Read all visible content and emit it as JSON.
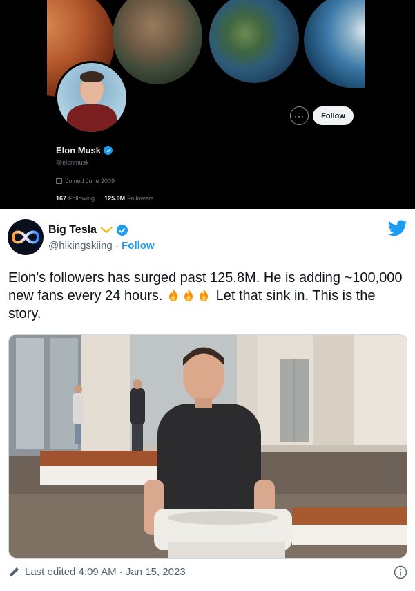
{
  "profile": {
    "name": "Elon Musk",
    "handle": "@elonmusk",
    "joined": "Joined June 2009",
    "following_count": "167",
    "following_label": "Following",
    "followers_count": "125.9M",
    "followers_label": "Followers",
    "more_label": "···",
    "follow_label": "Follow"
  },
  "tweet": {
    "author_name": "Big Tesla",
    "author_handle": "@hikingskiing",
    "separator": "·",
    "follow_label": "Follow",
    "text_part1": "Elon’s followers has surged past 125.8M. He is adding ~100,000 new fans every 24 hours.",
    "text_part2": "Let that sink in. This is the story.",
    "flame_count": 3,
    "last_edited": "Last edited 4:09 AM · Jan 15, 2023"
  },
  "colors": {
    "twitter_blue": "#1d9bf0",
    "text_primary": "#0f1419",
    "text_secondary": "#536471"
  },
  "icons": [
    "twitter-bird-icon",
    "verified-badge-icon",
    "affiliate-badge-icon",
    "fire-emoji-icon",
    "pencil-edit-icon",
    "info-icon",
    "calendar-icon",
    "more-dots-icon"
  ]
}
